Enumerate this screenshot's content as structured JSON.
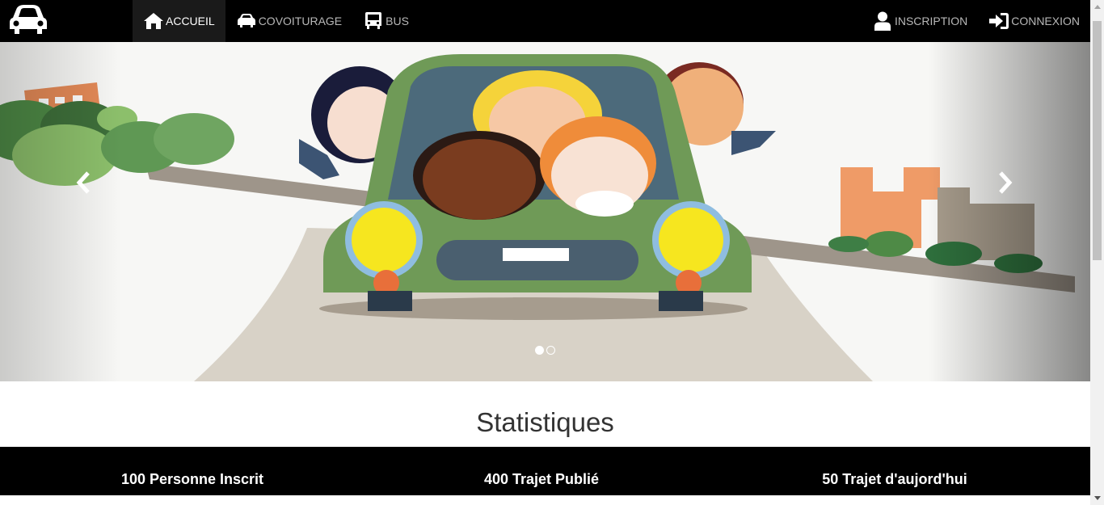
{
  "navbar": {
    "brand_icon": "car-front-icon",
    "left_items": [
      {
        "label": "ACCUEIL",
        "icon": "home-icon",
        "active": true
      },
      {
        "label": "COVOITURAGE",
        "icon": "car-icon",
        "active": false
      },
      {
        "label": "BUS",
        "icon": "bus-icon",
        "active": false
      }
    ],
    "right_items": [
      {
        "label": "INSCRIPTION",
        "icon": "user-icon"
      },
      {
        "label": "CONNEXION",
        "icon": "sign-in-icon"
      }
    ]
  },
  "carousel": {
    "prev_icon": "chevron-left-icon",
    "next_icon": "chevron-right-icon",
    "slide_count": 2,
    "active_slide": 1
  },
  "stats": {
    "title": "Statistiques",
    "items": [
      {
        "label": "100 Personne Inscrit"
      },
      {
        "label": "400 Trajet Publié"
      },
      {
        "label": "50 Trajet d'aujord'hui"
      }
    ]
  },
  "colors": {
    "navbar_bg": "#000000",
    "car_body": "#6f9a57",
    "stats_bar_bg": "#000000"
  }
}
